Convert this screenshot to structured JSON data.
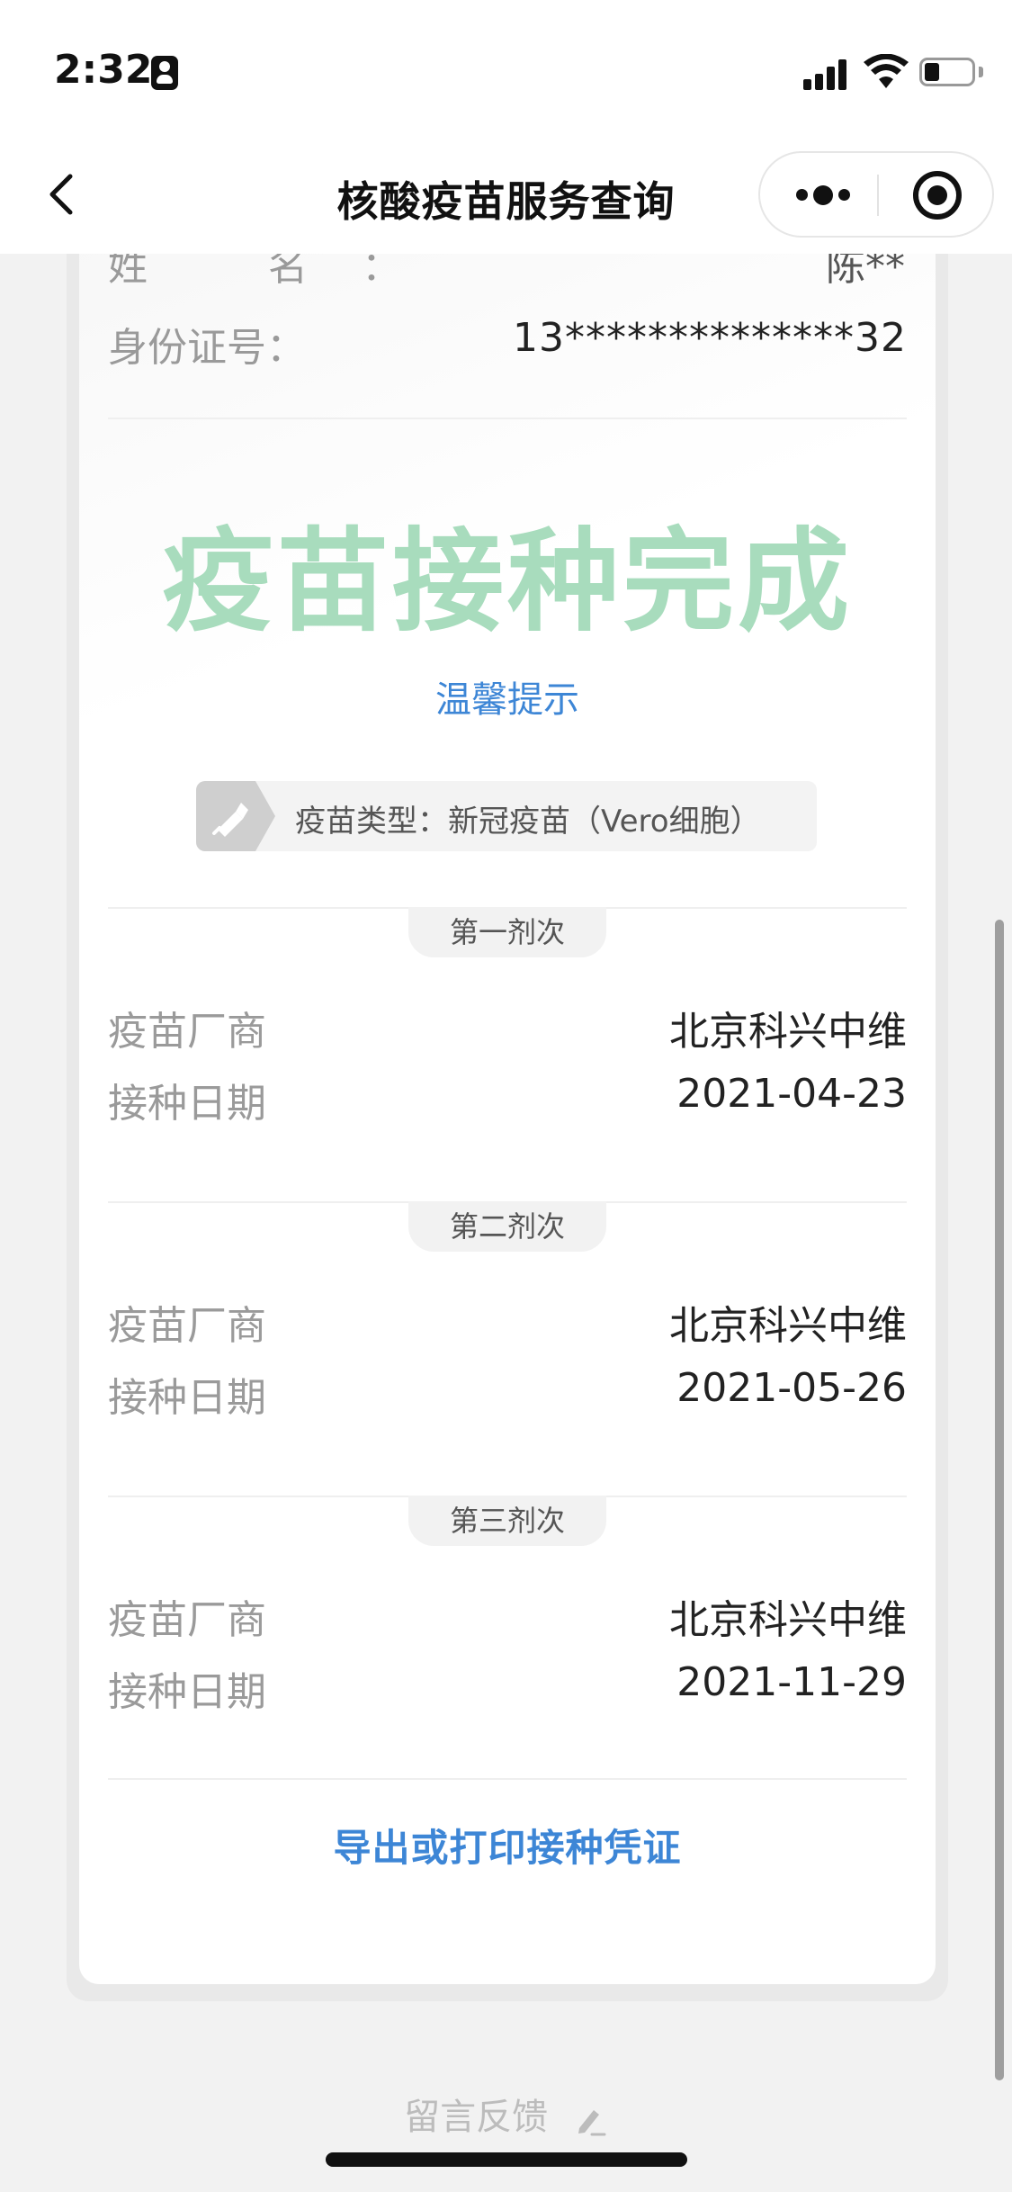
{
  "status_bar": {
    "time": "2:32"
  },
  "nav": {
    "title": "核酸疫苗服务查询"
  },
  "person": {
    "name_label": "姓    名：",
    "name_value": "陈**",
    "id_label": "身份证号：",
    "id_value": "13**************32"
  },
  "result": {
    "status": "疫苗接种完成",
    "tip_link": "温馨提示",
    "vaccine_type": "疫苗类型：新冠疫苗（Vero细胞）"
  },
  "doses": [
    {
      "title": "第一剂次",
      "manufacturer_label": "疫苗厂商",
      "manufacturer": "北京科兴中维",
      "date_label": "接种日期",
      "date": "2021-04-23"
    },
    {
      "title": "第二剂次",
      "manufacturer_label": "疫苗厂商",
      "manufacturer": "北京科兴中维",
      "date_label": "接种日期",
      "date": "2021-05-26"
    },
    {
      "title": "第三剂次",
      "manufacturer_label": "疫苗厂商",
      "manufacturer": "北京科兴中维",
      "date_label": "接种日期",
      "date": "2021-11-29"
    }
  ],
  "actions": {
    "export": "导出或打印接种凭证",
    "feedback": "留言反馈"
  },
  "icons": {
    "back": "chevron-left-icon",
    "more": "more-dots-icon",
    "close": "target-close-icon",
    "vaccine": "syringe-icon",
    "feedback": "pencil-icon"
  },
  "colors": {
    "status_green": "#a8dcbd",
    "link_blue": "#3d86d6"
  }
}
